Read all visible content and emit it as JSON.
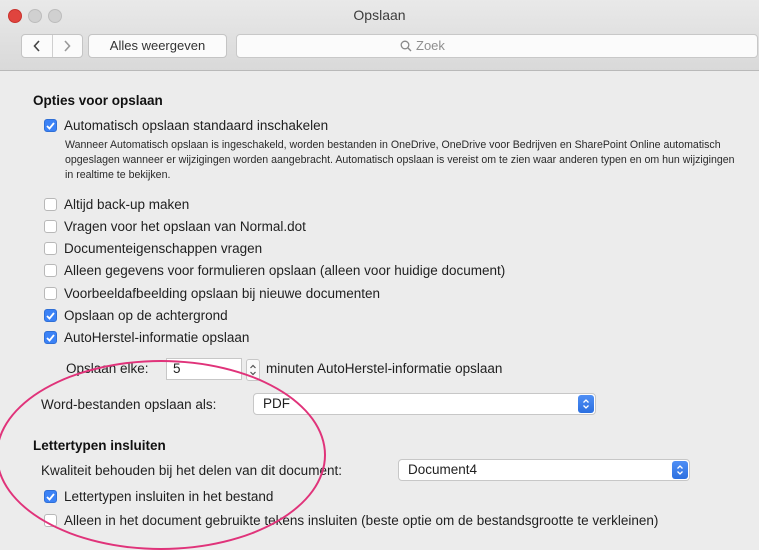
{
  "window": {
    "title": "Opslaan"
  },
  "toolbar": {
    "back_icon": "chevron-left-icon",
    "forward_icon": "chevron-right-icon",
    "show_all_label": "Alles weergeven",
    "search_placeholder": "Zoek"
  },
  "save_options": {
    "title": "Opties voor opslaan",
    "autosave": {
      "label": "Automatisch opslaan standaard inschakelen",
      "checked": true,
      "description": "Wanneer Automatisch opslaan is ingeschakeld, worden bestanden in OneDrive, OneDrive voor Bedrijven en SharePoint Online automatisch opgeslagen wanneer er wijzigingen worden aangebracht. Automatisch opslaan is vereist om te zien waar anderen typen en om hun wijzigingen in realtime te bekijken."
    },
    "checkboxes": [
      {
        "label": "Altijd back-up maken",
        "checked": false
      },
      {
        "label": "Vragen voor het opslaan van Normal.dot",
        "checked": false
      },
      {
        "label": "Documenteigenschappen vragen",
        "checked": false
      },
      {
        "label": "Alleen gegevens voor formulieren opslaan (alleen voor huidige document)",
        "checked": false
      },
      {
        "label": "Voorbeeldafbeelding opslaan bij nieuwe documenten",
        "checked": false
      },
      {
        "label": "Opslaan op de achtergrond",
        "checked": true
      },
      {
        "label": "AutoHerstel-informatie opslaan",
        "checked": true
      }
    ],
    "autorecover": {
      "label": "Opslaan elke:",
      "value": "5",
      "suffix": "minuten AutoHerstel-informatie opslaan"
    },
    "format": {
      "label": "Word-bestanden opslaan als:",
      "value": "PDF"
    }
  },
  "embed_fonts": {
    "title": "Lettertypen insluiten",
    "quality": {
      "label": "Kwaliteit behouden bij het delen van dit document:",
      "value": "Document4"
    },
    "checkboxes": [
      {
        "label": "Lettertypen insluiten in het bestand",
        "checked": true
      },
      {
        "label": "Alleen in het document gebruikte tekens insluiten (beste optie om de bestandsgrootte te verkleinen)",
        "checked": false
      }
    ]
  },
  "colors": {
    "accent": "#3b82f6",
    "highlight": "#e0337a",
    "close": "#e0443e"
  }
}
